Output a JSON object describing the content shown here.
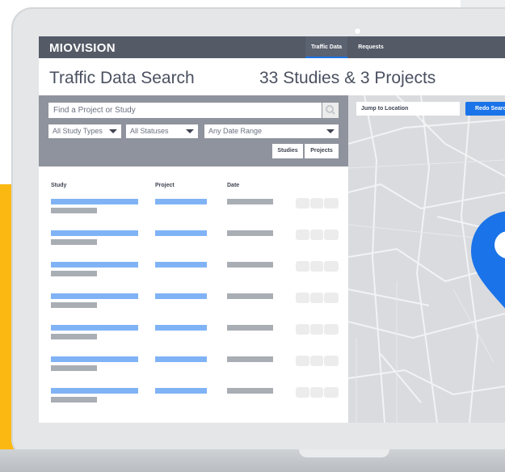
{
  "brand": {
    "logo_text": "MIOVISION"
  },
  "nav": {
    "items": [
      {
        "label": "Traffic Data",
        "active": true
      },
      {
        "label": "Requests",
        "active": false
      }
    ]
  },
  "page": {
    "title": "Traffic Data Search",
    "result_count": "33 Studies & 3 Projects"
  },
  "filters": {
    "search_placeholder": "Find a Project or Study",
    "study_types": "All Study Types",
    "statuses": "All Statuses",
    "date_range": "Any Date Range",
    "toggle_studies": "Studies",
    "toggle_projects": "Projects"
  },
  "table": {
    "columns": [
      "Study",
      "Project",
      "Date"
    ],
    "row_count": 7
  },
  "map": {
    "jump_label": "Jump to Location",
    "redo_label": "Redo Search"
  },
  "colors": {
    "accent": "#1a73e8",
    "topbar": "#545a66",
    "placeholder_blue": "#80b3f6",
    "placeholder_gray": "#a9adb4",
    "yellow": "#fcb812"
  }
}
